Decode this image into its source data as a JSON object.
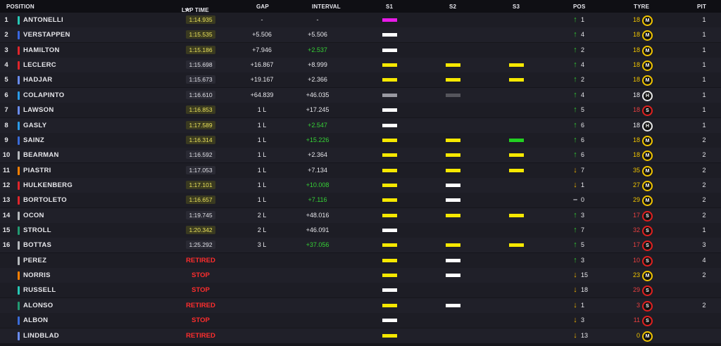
{
  "header": {
    "position": "POSITION",
    "lap_time": "LAP TIME",
    "gap": "GAP",
    "interval": "INTERVAL",
    "s1": "S1",
    "s2": "S2",
    "s3": "S3",
    "pos": "POS",
    "tyre": "TYRE",
    "pit": "PIT"
  },
  "colors": {
    "purple": "#e81be8",
    "yellow": "#f6e800",
    "white": "#ffffff",
    "grey": "#9a9aa2",
    "darkgrey": "#55555c",
    "green": "#22d022",
    "medium": "#f0c400",
    "soft": "#e02020",
    "hard": "#e8e8e8"
  },
  "drivers": [
    {
      "pos": "1",
      "name": "ANTONELLI",
      "team_color": "#27c9b6",
      "lap": "1:14.935",
      "lap_style": "chip",
      "gap": "-",
      "interval": "-",
      "interval_green": false,
      "s1": "purple",
      "s2": "",
      "s3": "",
      "dir": "up",
      "pos_change": "1",
      "tyre_laps": "18",
      "tyre": "M",
      "pit": "1"
    },
    {
      "pos": "2",
      "name": "VERSTAPPEN",
      "team_color": "#3a67e0",
      "lap": "1:15.535",
      "lap_style": "chip",
      "gap": "+5.506",
      "interval": "+5.506",
      "interval_green": false,
      "s1": "white",
      "s2": "",
      "s3": "",
      "dir": "up",
      "pos_change": "4",
      "tyre_laps": "18",
      "tyre": "M",
      "pit": "1"
    },
    {
      "pos": "3",
      "name": "HAMILTON",
      "team_color": "#e0252b",
      "lap": "1:15.186",
      "lap_style": "chip",
      "gap": "+7.946",
      "interval": "+2.537",
      "interval_green": true,
      "s1": "white",
      "s2": "",
      "s3": "",
      "dir": "up",
      "pos_change": "2",
      "tyre_laps": "18",
      "tyre": "M",
      "pit": "1"
    },
    {
      "pos": "4",
      "name": "LECLERC",
      "team_color": "#e0252b",
      "lap": "1:15.698",
      "lap_style": "plain",
      "gap": "+16.867",
      "interval": "+8.999",
      "interval_green": false,
      "s1": "yellow",
      "s2": "yellow",
      "s3": "yellow",
      "dir": "up",
      "pos_change": "4",
      "tyre_laps": "18",
      "tyre": "M",
      "pit": "1"
    },
    {
      "pos": "5",
      "name": "HADJAR",
      "team_color": "#6a8cf0",
      "lap": "1:15.673",
      "lap_style": "plain",
      "gap": "+19.167",
      "interval": "+2.366",
      "interval_green": false,
      "s1": "yellow",
      "s2": "yellow",
      "s3": "yellow",
      "dir": "up",
      "pos_change": "2",
      "tyre_laps": "18",
      "tyre": "M",
      "pit": "1"
    },
    {
      "pos": "6",
      "name": "COLAPINTO",
      "team_color": "#2b9be8",
      "lap": "1:16.610",
      "lap_style": "plain",
      "gap": "+64.839",
      "interval": "+46.035",
      "interval_green": false,
      "s1": "grey",
      "s2": "darkgrey",
      "s3": "",
      "dir": "up",
      "pos_change": "4",
      "tyre_laps": "18",
      "tyre": "H",
      "pit": "1"
    },
    {
      "pos": "7",
      "name": "LAWSON",
      "team_color": "#6a8cf0",
      "lap": "1:16.853",
      "lap_style": "chip",
      "gap": "1 L",
      "interval": "+17.245",
      "interval_green": false,
      "s1": "white",
      "s2": "",
      "s3": "",
      "dir": "up",
      "pos_change": "5",
      "tyre_laps": "18",
      "tyre": "S",
      "pit": "1"
    },
    {
      "pos": "8",
      "name": "GASLY",
      "team_color": "#2b9be8",
      "lap": "1:17.589",
      "lap_style": "chip",
      "gap": "1 L",
      "interval": "+2.547",
      "interval_green": true,
      "s1": "white",
      "s2": "",
      "s3": "",
      "dir": "up",
      "pos_change": "6",
      "tyre_laps": "18",
      "tyre": "H",
      "pit": "1"
    },
    {
      "pos": "9",
      "name": "SAINZ",
      "team_color": "#3a6bd8",
      "lap": "1:16.314",
      "lap_style": "chip",
      "gap": "1 L",
      "interval": "+15.226",
      "interval_green": true,
      "s1": "yellow",
      "s2": "yellow",
      "s3": "green",
      "dir": "up",
      "pos_change": "6",
      "tyre_laps": "18",
      "tyre": "M",
      "pit": "2"
    },
    {
      "pos": "10",
      "name": "BEARMAN",
      "team_color": "#b6babd",
      "lap": "1:16.592",
      "lap_style": "plain",
      "gap": "1 L",
      "interval": "+2.364",
      "interval_green": false,
      "s1": "yellow",
      "s2": "yellow",
      "s3": "yellow",
      "dir": "up",
      "pos_change": "6",
      "tyre_laps": "18",
      "tyre": "M",
      "pit": "2"
    },
    {
      "pos": "11",
      "name": "PIASTRI",
      "team_color": "#ff8000",
      "lap": "1:17.053",
      "lap_style": "plain",
      "gap": "1 L",
      "interval": "+7.134",
      "interval_green": false,
      "s1": "yellow",
      "s2": "yellow",
      "s3": "yellow",
      "dir": "down",
      "pos_change": "7",
      "tyre_laps": "35",
      "tyre": "M",
      "pit": "2"
    },
    {
      "pos": "12",
      "name": "HULKENBERG",
      "team_color": "#e0252b",
      "lap": "1:17.101",
      "lap_style": "chip",
      "gap": "1 L",
      "interval": "+10.008",
      "interval_green": true,
      "s1": "yellow",
      "s2": "white",
      "s3": "",
      "dir": "down",
      "pos_change": "1",
      "tyre_laps": "27",
      "tyre": "M",
      "pit": "2"
    },
    {
      "pos": "13",
      "name": "BORTOLETO",
      "team_color": "#e0252b",
      "lap": "1:16.657",
      "lap_style": "chip",
      "gap": "1 L",
      "interval": "+7.116",
      "interval_green": true,
      "s1": "yellow",
      "s2": "white",
      "s3": "",
      "dir": "same",
      "pos_change": "0",
      "tyre_laps": "29",
      "tyre": "M",
      "pit": "2"
    },
    {
      "pos": "14",
      "name": "OCON",
      "team_color": "#b6babd",
      "lap": "1:19.745",
      "lap_style": "plain",
      "gap": "2 L",
      "interval": "+48.016",
      "interval_green": false,
      "s1": "yellow",
      "s2": "yellow",
      "s3": "yellow",
      "dir": "up",
      "pos_change": "3",
      "tyre_laps": "17",
      "tyre": "S",
      "pit": "2"
    },
    {
      "pos": "15",
      "name": "STROLL",
      "team_color": "#229971",
      "lap": "1:20.342",
      "lap_style": "chip",
      "gap": "2 L",
      "interval": "+46.091",
      "interval_green": false,
      "s1": "white",
      "s2": "",
      "s3": "",
      "dir": "up",
      "pos_change": "7",
      "tyre_laps": "32",
      "tyre": "S",
      "pit": "1"
    },
    {
      "pos": "16",
      "name": "BOTTAS",
      "team_color": "#b6babd",
      "lap": "1:25.292",
      "lap_style": "plain",
      "gap": "3 L",
      "interval": "+37.056",
      "interval_green": true,
      "s1": "yellow",
      "s2": "yellow",
      "s3": "yellow",
      "dir": "up",
      "pos_change": "5",
      "tyre_laps": "17",
      "tyre": "S",
      "pit": "3"
    },
    {
      "pos": "",
      "name": "PEREZ",
      "team_color": "#b6babd",
      "lap": "RETIRED",
      "lap_style": "status",
      "gap": "",
      "interval": "",
      "interval_green": false,
      "s1": "yellow",
      "s2": "white",
      "s3": "",
      "dir": "up",
      "pos_change": "3",
      "tyre_laps": "10",
      "tyre": "S",
      "pit": "4"
    },
    {
      "pos": "",
      "name": "NORRIS",
      "team_color": "#ff8000",
      "lap": "STOP",
      "lap_style": "status",
      "gap": "",
      "interval": "",
      "interval_green": false,
      "s1": "yellow",
      "s2": "white",
      "s3": "",
      "dir": "down",
      "pos_change": "15",
      "tyre_laps": "23",
      "tyre": "M",
      "pit": "2"
    },
    {
      "pos": "",
      "name": "RUSSELL",
      "team_color": "#27c9b6",
      "lap": "STOP",
      "lap_style": "status",
      "gap": "",
      "interval": "",
      "interval_green": false,
      "s1": "white",
      "s2": "",
      "s3": "",
      "dir": "down",
      "pos_change": "18",
      "tyre_laps": "29",
      "tyre": "S",
      "pit": ""
    },
    {
      "pos": "",
      "name": "ALONSO",
      "team_color": "#229971",
      "lap": "RETIRED",
      "lap_style": "status",
      "gap": "",
      "interval": "",
      "interval_green": false,
      "s1": "yellow",
      "s2": "white",
      "s3": "",
      "dir": "down",
      "pos_change": "1",
      "tyre_laps": "3",
      "tyre": "S",
      "pit": "2"
    },
    {
      "pos": "",
      "name": "ALBON",
      "team_color": "#3a6bd8",
      "lap": "STOP",
      "lap_style": "status",
      "gap": "",
      "interval": "",
      "interval_green": false,
      "s1": "white",
      "s2": "",
      "s3": "",
      "dir": "down",
      "pos_change": "3",
      "tyre_laps": "11",
      "tyre": "S",
      "pit": ""
    },
    {
      "pos": "",
      "name": "LINDBLAD",
      "team_color": "#6a8cf0",
      "lap": "RETIRED",
      "lap_style": "status",
      "gap": "",
      "interval": "",
      "interval_green": false,
      "s1": "yellow",
      "s2": "",
      "s3": "",
      "dir": "down",
      "pos_change": "13",
      "tyre_laps": "0",
      "tyre": "M",
      "pit": ""
    }
  ]
}
